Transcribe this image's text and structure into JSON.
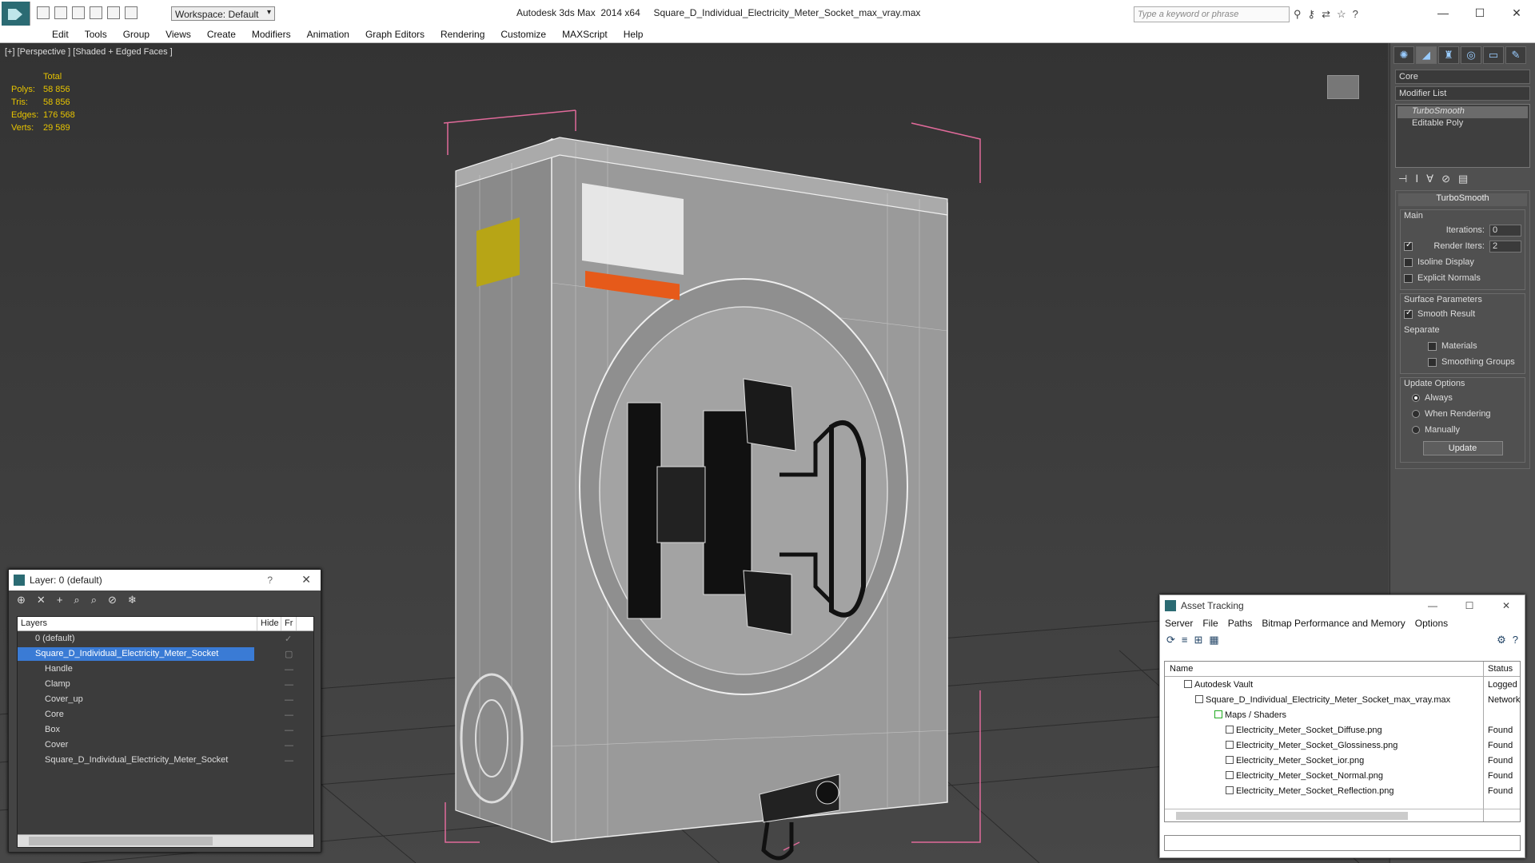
{
  "titlebar": {
    "workspace": "Workspace: Default",
    "app_title": "Autodesk 3ds Max  2014 x64",
    "file_title": "Square_D_Individual_Electricity_Meter_Socket_max_vray.max",
    "search_placeholder": "Type a keyword or phrase"
  },
  "menu": [
    "Edit",
    "Tools",
    "Group",
    "Views",
    "Create",
    "Modifiers",
    "Animation",
    "Graph Editors",
    "Rendering",
    "Customize",
    "MAXScript",
    "Help"
  ],
  "viewport": {
    "label": "[+] [Perspective ] [Shaded + Edged Faces ]",
    "stats": {
      "header": "Total",
      "rows": [
        {
          "k": "Polys:",
          "v": "58 856"
        },
        {
          "k": "Tris:",
          "v": "58 856"
        },
        {
          "k": "Edges:",
          "v": "176 568"
        },
        {
          "k": "Verts:",
          "v": "29 589"
        }
      ]
    }
  },
  "command_panel": {
    "object_name": "Core",
    "modifier_list": "Modifier List",
    "stack": [
      "TurboSmooth",
      "Editable Poly"
    ],
    "rollout_title": "TurboSmooth",
    "main": {
      "title": "Main",
      "iterations_label": "Iterations:",
      "iterations_value": "0",
      "render_iters_label": "Render Iters:",
      "render_iters_value": "2",
      "isoline": "Isoline Display",
      "explicit": "Explicit Normals"
    },
    "surface": {
      "title": "Surface Parameters",
      "smooth": "Smooth Result",
      "separate": "Separate",
      "materials": "Materials",
      "smoothing": "Smoothing Groups"
    },
    "update": {
      "title": "Update Options",
      "always": "Always",
      "when": "When Rendering",
      "manually": "Manually",
      "button": "Update"
    }
  },
  "layer_dialog": {
    "title": "Layer: 0 (default)",
    "help": "?",
    "col_layers": "Layers",
    "col_hide": "Hide",
    "col_fr": "Fr",
    "rows": [
      {
        "name": "0 (default)",
        "indent": 1
      },
      {
        "name": "Square_D_Individual_Electricity_Meter_Socket",
        "indent": 1
      },
      {
        "name": "Handle",
        "indent": 2
      },
      {
        "name": "Clamp",
        "indent": 2
      },
      {
        "name": "Cover_up",
        "indent": 2
      },
      {
        "name": "Core",
        "indent": 2
      },
      {
        "name": "Box",
        "indent": 2
      },
      {
        "name": "Cover",
        "indent": 2
      },
      {
        "name": "Square_D_Individual_Electricity_Meter_Socket",
        "indent": 2
      }
    ]
  },
  "asset_dialog": {
    "title": "Asset Tracking",
    "menu": [
      "Server",
      "File",
      "Paths",
      "Bitmap Performance and Memory",
      "Options"
    ],
    "col_name": "Name",
    "col_status": "Status",
    "rows": [
      {
        "name": "Autodesk Vault",
        "status": "Logged",
        "indent": 1
      },
      {
        "name": "Square_D_Individual_Electricity_Meter_Socket_max_vray.max",
        "status": "Network",
        "indent": 2
      },
      {
        "name": "Maps / Shaders",
        "status": "",
        "indent": 3
      },
      {
        "name": "Electricity_Meter_Socket_Diffuse.png",
        "status": "Found",
        "indent": 4
      },
      {
        "name": "Electricity_Meter_Socket_Glossiness.png",
        "status": "Found",
        "indent": 4
      },
      {
        "name": "Electricity_Meter_Socket_ior.png",
        "status": "Found",
        "indent": 4
      },
      {
        "name": "Electricity_Meter_Socket_Normal.png",
        "status": "Found",
        "indent": 4
      },
      {
        "name": "Electricity_Meter_Socket_Reflection.png",
        "status": "Found",
        "indent": 4
      }
    ]
  }
}
